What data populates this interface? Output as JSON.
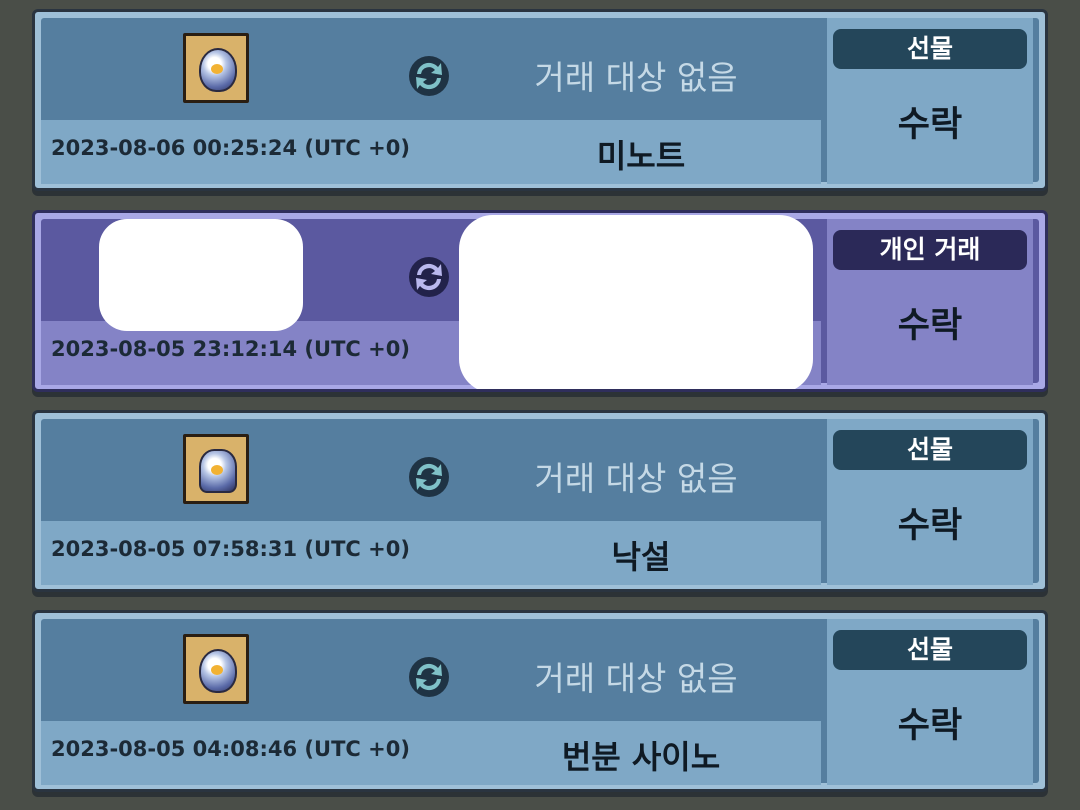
{
  "trades": [
    {
      "item_icon": "orb-item-icon",
      "target_text": "거래 대상 없음",
      "date": "2023-08-06 00:25:24 (UTC +0)",
      "partner": "미노트",
      "type_badge": "선물",
      "status": "수락",
      "theme": "gift"
    },
    {
      "item_icon": "redacted",
      "target_text": "",
      "date": "2023-08-05 23:12:14 (UTC +0)",
      "partner": "",
      "type_badge": "개인 거래",
      "status": "수락",
      "theme": "private"
    },
    {
      "item_icon": "crest-item-icon",
      "target_text": "거래 대상 없음",
      "date": "2023-08-05 07:58:31 (UTC +0)",
      "partner": "낙설",
      "type_badge": "선물",
      "status": "수락",
      "theme": "gift"
    },
    {
      "item_icon": "orb-item-icon",
      "target_text": "거래 대상 없음",
      "date": "2023-08-05 04:08:46 (UTC +0)",
      "partner": "번분 사이노",
      "type_badge": "선물",
      "status": "수락",
      "theme": "gift"
    }
  ],
  "colors": {
    "gift_inner": "#557e9f",
    "gift_light": "#7fa8c6",
    "gift_badge": "#24465a",
    "private_inner": "#5b59a0",
    "private_light": "#8483c6",
    "private_badge": "#2b2958",
    "item_slot": "#d9b26a"
  }
}
